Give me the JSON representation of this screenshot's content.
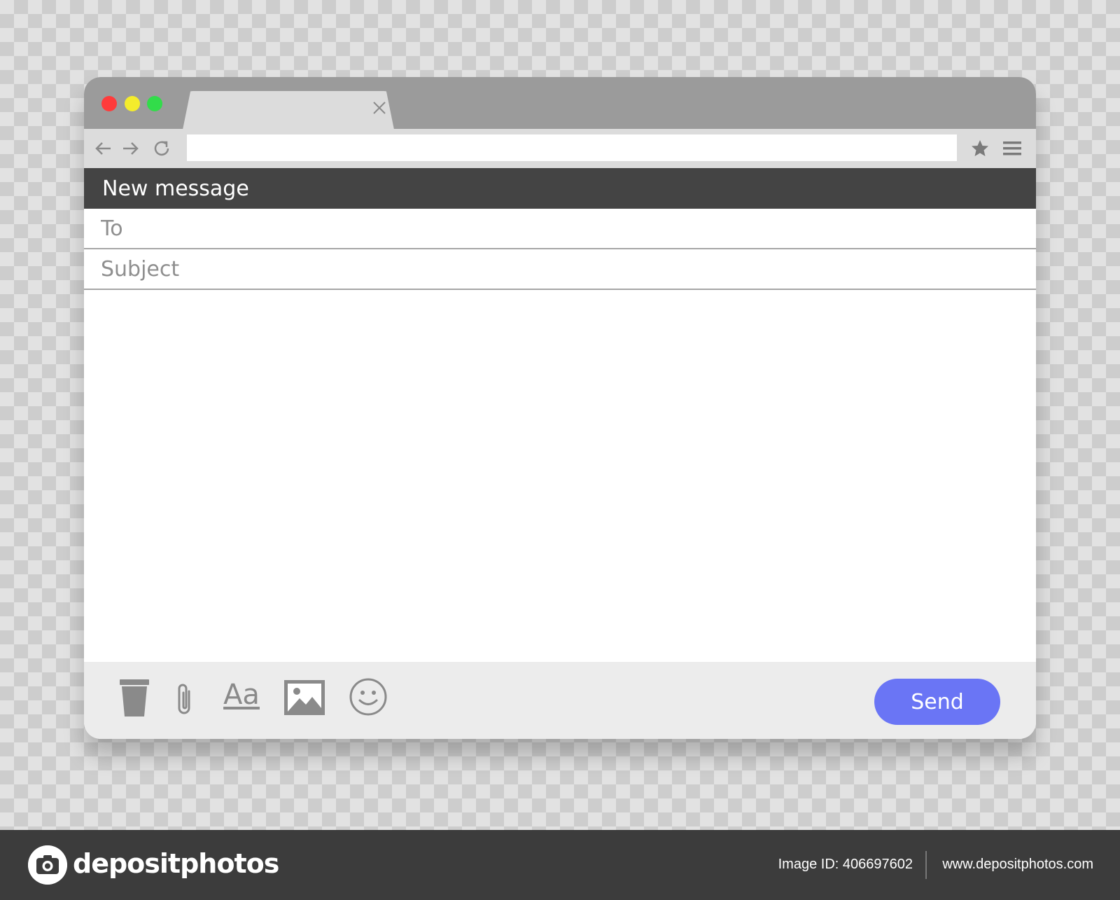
{
  "browser": {
    "tab": {
      "close_icon": "close-icon"
    },
    "toolbar": {
      "back_icon": "arrow-left-icon",
      "forward_icon": "arrow-right-icon",
      "reload_icon": "reload-icon",
      "url_value": "",
      "bookmark_icon": "star-icon",
      "menu_icon": "hamburger-menu-icon"
    }
  },
  "compose": {
    "title": "New message",
    "to": {
      "placeholder": "To",
      "value": ""
    },
    "subject": {
      "placeholder": "Subject",
      "value": ""
    },
    "body": {
      "value": ""
    },
    "toolbar": {
      "format_label": "Aa",
      "send_label": "Send",
      "icons": [
        "trash-icon",
        "paperclip-icon",
        "format-text-icon",
        "image-icon",
        "emoji-icon"
      ]
    }
  },
  "watermark": {
    "brand": "depositphotos",
    "image_id": "Image ID: 406697602",
    "site": "www.depositphotos.com"
  },
  "colors": {
    "close": "#ff3b3b",
    "minimize": "#f4ec2c",
    "maximize": "#32dc4a",
    "titlebar": "#9b9b9b",
    "toolbar": "#dcdcdc",
    "header": "#444444",
    "send_button": "#6a75f5",
    "footer": "#ececec",
    "bottom_bar": "#3c3c3c"
  }
}
